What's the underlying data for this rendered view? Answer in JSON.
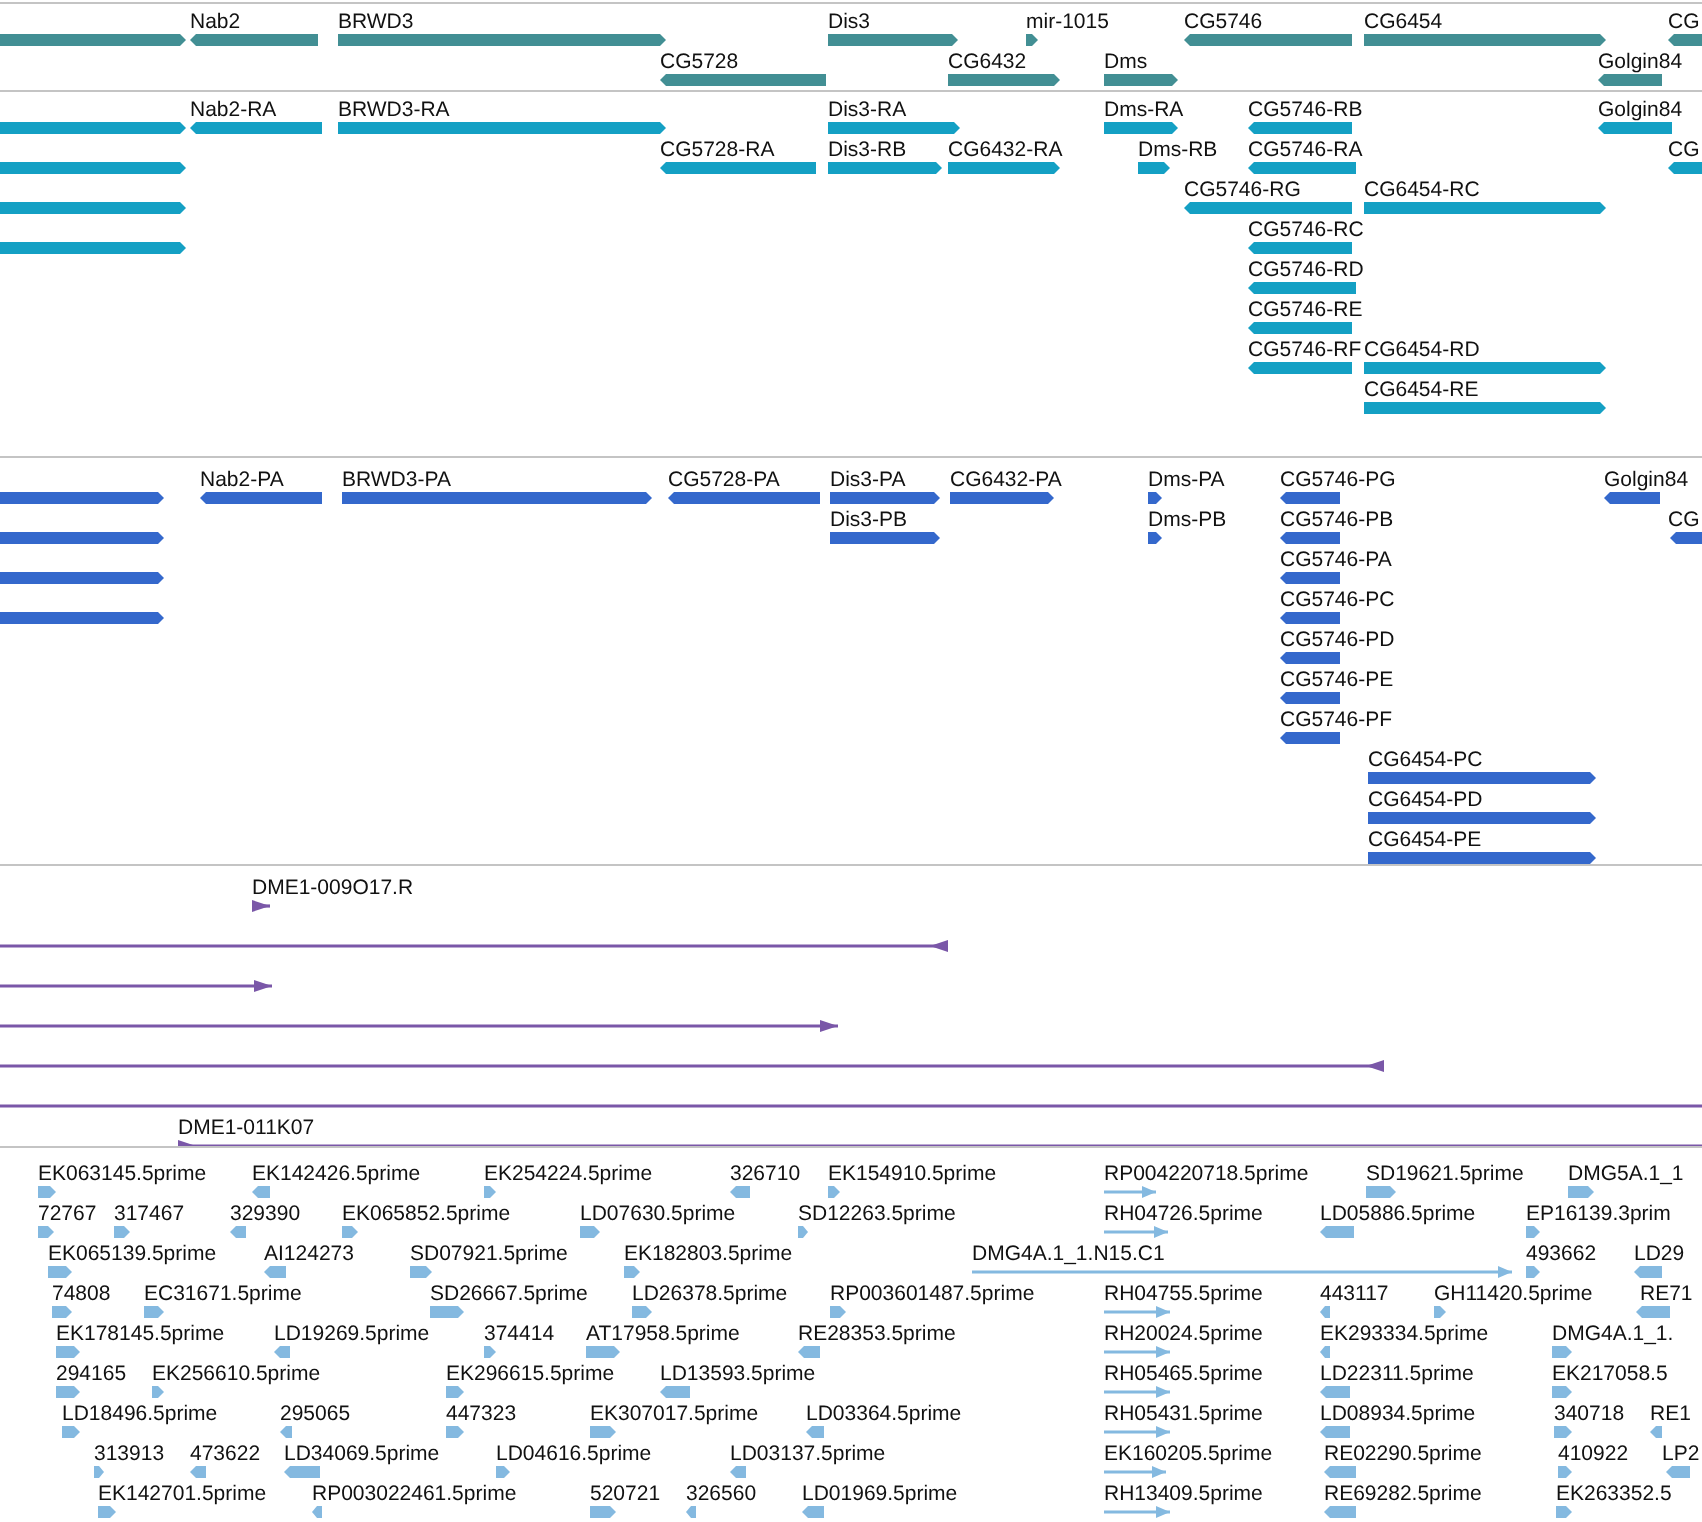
{
  "tracks": [
    {
      "kind": "gene",
      "features": [
        {
          "forward": true
        },
        {
          "label": "Nab2",
          "forward": false
        },
        {
          "label": "BRWD3",
          "forward": true
        },
        {
          "label": "Dis3",
          "forward": true
        },
        {
          "label": "mir-1015",
          "forward": true
        },
        {
          "label": "CG5746",
          "forward": false
        },
        {
          "label": "CG6454",
          "forward": true
        },
        {
          "label": "CG",
          "forward": false
        },
        {
          "label": "CG5728",
          "forward": false
        },
        {
          "label": "CG6432",
          "forward": true
        },
        {
          "label": "Dms",
          "forward": true
        },
        {
          "label": "Golgin84",
          "forward": false
        }
      ]
    },
    {
      "kind": "transcript",
      "features": [
        {
          "forward": true
        },
        {
          "forward": true
        },
        {
          "forward": true
        },
        {
          "forward": true
        },
        {
          "label": "Nab2-RA",
          "forward": false
        },
        {
          "label": "BRWD3-RA",
          "forward": true
        },
        {
          "label": "CG5728-RA",
          "forward": false
        },
        {
          "label": "Dis3-RA",
          "forward": true
        },
        {
          "label": "Dis3-RB",
          "forward": true
        },
        {
          "label": "CG6432-RA",
          "forward": true
        },
        {
          "label": "Dms-RA",
          "forward": true
        },
        {
          "label": "Dms-RB",
          "forward": true
        },
        {
          "label": "CG5746-RB",
          "forward": false
        },
        {
          "label": "CG5746-RA",
          "forward": false
        },
        {
          "label": "CG5746-RG",
          "forward": false
        },
        {
          "label": "CG6454-RC",
          "forward": true
        },
        {
          "label": "CG5746-RC",
          "forward": false
        },
        {
          "label": "CG5746-RD",
          "forward": false
        },
        {
          "label": "CG5746-RE",
          "forward": false
        },
        {
          "label": "CG5746-RF",
          "forward": false
        },
        {
          "label": "CG6454-RD",
          "forward": true
        },
        {
          "label": "CG6454-RE",
          "forward": true
        },
        {
          "label": "Golgin84",
          "forward": false
        },
        {
          "label": "CG",
          "forward": false
        }
      ]
    },
    {
      "kind": "protein",
      "features": [
        {
          "forward": true
        },
        {
          "forward": true
        },
        {
          "forward": true
        },
        {
          "forward": true
        },
        {
          "label": "Nab2-PA",
          "forward": false
        },
        {
          "label": "BRWD3-PA",
          "forward": true
        },
        {
          "label": "CG5728-PA",
          "forward": false
        },
        {
          "label": "Dis3-PA",
          "forward": true
        },
        {
          "label": "Dis3-PB",
          "forward": true
        },
        {
          "label": "CG6432-PA",
          "forward": true
        },
        {
          "label": "Dms-PA",
          "forward": true
        },
        {
          "label": "Dms-PB",
          "forward": true
        },
        {
          "label": "CG5746-PG",
          "forward": false
        },
        {
          "label": "CG5746-PB",
          "forward": false
        },
        {
          "label": "CG5746-PA",
          "forward": false
        },
        {
          "label": "CG5746-PC",
          "forward": false
        },
        {
          "label": "CG5746-PD",
          "forward": false
        },
        {
          "label": "CG5746-PE",
          "forward": false
        },
        {
          "label": "CG5746-PF",
          "forward": false
        },
        {
          "label": "CG6454-PC",
          "forward": true
        },
        {
          "label": "CG6454-PD",
          "forward": true
        },
        {
          "label": "CG6454-PE",
          "forward": true
        },
        {
          "label": "Golgin84",
          "forward": false
        },
        {
          "label": "CG",
          "forward": false
        }
      ]
    },
    {
      "kind": "clone",
      "features": [
        {
          "label": "DME1-009O17.R",
          "forward": true
        },
        {
          "forward": false
        },
        {
          "forward": true
        },
        {
          "forward": true
        },
        {
          "forward": false
        },
        {
          "kind": "line"
        },
        {
          "label": "DME1-011K07",
          "forward": true
        }
      ]
    },
    {
      "kind": "est",
      "features": [
        {
          "label": "EK063145.5prime",
          "forward": true
        },
        {
          "label": "EK142426.5prime",
          "forward": false
        },
        {
          "label": "EK254224.5prime",
          "forward": true
        },
        {
          "label": "326710",
          "forward": false
        },
        {
          "label": "EK154910.5prime",
          "forward": true
        },
        {
          "label": "RP004220718.5prime",
          "forward": true
        },
        {
          "label": "SD19621.5prime",
          "forward": true
        },
        {
          "label": "DMG5A.1_1",
          "forward": true
        },
        {
          "label": "72767",
          "forward": true
        },
        {
          "label": "317467",
          "forward": true
        },
        {
          "label": "329390",
          "forward": false
        },
        {
          "label": "EK065852.5prime",
          "forward": true
        },
        {
          "label": "LD07630.5prime",
          "forward": true
        },
        {
          "label": "SD12263.5prime",
          "forward": true
        },
        {
          "label": "RH04726.5prime",
          "forward": true
        },
        {
          "label": "LD05886.5prime",
          "forward": false
        },
        {
          "label": "EP16139.3prim",
          "forward": true
        },
        {
          "label": "EK065139.5prime",
          "forward": true
        },
        {
          "label": "AI124273",
          "forward": false
        },
        {
          "label": "SD07921.5prime",
          "forward": true
        },
        {
          "label": "EK182803.5prime",
          "forward": true
        },
        {
          "label": "DMG4A.1_1.N15.C1",
          "forward": true
        },
        {
          "label": "493662",
          "forward": true
        },
        {
          "label": "LD29",
          "forward": false
        },
        {
          "label": "74808",
          "forward": true
        },
        {
          "label": "EC31671.5prime",
          "forward": true
        },
        {
          "label": "SD26667.5prime",
          "forward": true
        },
        {
          "label": "LD26378.5prime",
          "forward": true
        },
        {
          "label": "RP003601487.5prime",
          "forward": true
        },
        {
          "label": "RH04755.5prime",
          "forward": true
        },
        {
          "label": "443117",
          "forward": false
        },
        {
          "label": "GH11420.5prime",
          "forward": true
        },
        {
          "label": "RE71",
          "forward": false
        },
        {
          "label": "EK178145.5prime",
          "forward": true
        },
        {
          "label": "LD19269.5prime",
          "forward": false
        },
        {
          "label": "374414",
          "forward": true
        },
        {
          "label": "AT17958.5prime",
          "forward": true
        },
        {
          "label": "RE28353.5prime",
          "forward": false
        },
        {
          "label": "RH20024.5prime",
          "forward": true
        },
        {
          "label": "EK293334.5prime",
          "forward": false
        },
        {
          "label": "DMG4A.1_1.",
          "forward": true
        },
        {
          "label": "294165",
          "forward": true
        },
        {
          "label": "EK256610.5prime",
          "forward": true
        },
        {
          "label": "EK296615.5prime",
          "forward": true
        },
        {
          "label": "LD13593.5prime",
          "forward": false
        },
        {
          "label": "RH05465.5prime",
          "forward": true
        },
        {
          "label": "LD22311.5prime",
          "forward": false
        },
        {
          "label": "EK217058.5",
          "forward": true
        },
        {
          "label": "LD18496.5prime",
          "forward": true
        },
        {
          "label": "295065",
          "forward": false
        },
        {
          "label": "447323",
          "forward": true
        },
        {
          "label": "EK307017.5prime",
          "forward": true
        },
        {
          "label": "LD03364.5prime",
          "forward": false
        },
        {
          "label": "RH05431.5prime",
          "forward": true
        },
        {
          "label": "LD08934.5prime",
          "forward": false
        },
        {
          "label": "340718",
          "forward": true
        },
        {
          "label": "RE1",
          "forward": false
        },
        {
          "label": "313913",
          "forward": true
        },
        {
          "label": "473622",
          "forward": false
        },
        {
          "label": "LD34069.5prime",
          "forward": false
        },
        {
          "label": "LD04616.5prime",
          "forward": true
        },
        {
          "label": "LD03137.5prime",
          "forward": false
        },
        {
          "label": "EK160205.5prime",
          "forward": true
        },
        {
          "label": "RE02290.5prime",
          "forward": false
        },
        {
          "label": "410922",
          "forward": true
        },
        {
          "label": "LP2",
          "forward": false
        },
        {
          "label": "EK142701.5prime",
          "forward": true
        },
        {
          "label": "RP003022461.5prime",
          "forward": false
        },
        {
          "label": "520721",
          "forward": true
        },
        {
          "label": "326560",
          "forward": false
        },
        {
          "label": "LD01969.5prime",
          "forward": false
        },
        {
          "label": "RH13409.5prime",
          "forward": true
        },
        {
          "label": "RE69282.5prime",
          "forward": false
        },
        {
          "label": "EK263352.5",
          "forward": true
        }
      ]
    }
  ]
}
